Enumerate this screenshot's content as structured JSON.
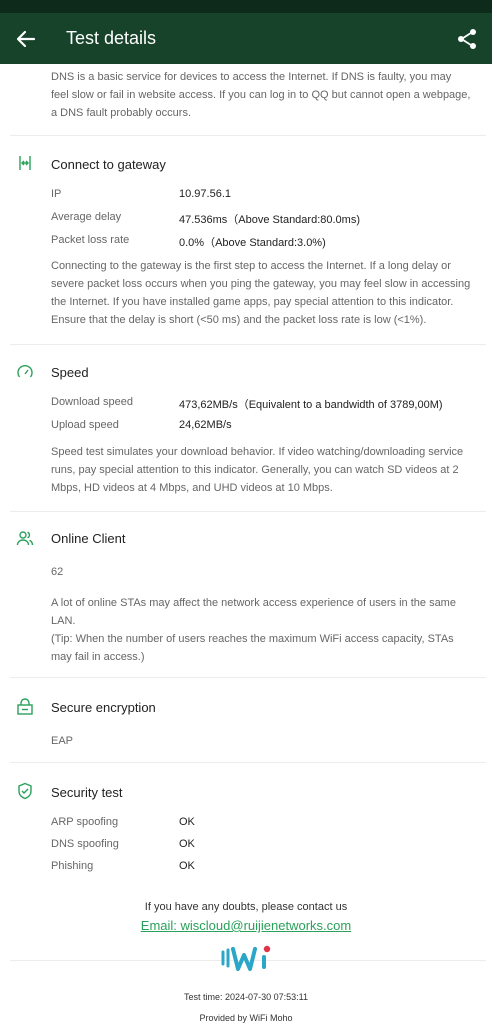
{
  "header": {
    "title": "Test details"
  },
  "dns": {
    "description": "DNS is a basic service for devices to access the Internet. If DNS is faulty, you may feel slow or fail in website access. If you can log in to QQ but cannot open a webpage, a DNS fault probably occurs."
  },
  "gateway": {
    "title": "Connect to gateway",
    "rows": [
      {
        "label": "IP",
        "value": "10.97.56.1"
      },
      {
        "label": "Average delay",
        "value": "47.536ms（Above Standard:80.0ms)"
      },
      {
        "label": "Packet loss rate",
        "value": "0.0%（Above Standard:3.0%)"
      }
    ],
    "description": "Connecting to the gateway is the first step to access the Internet. If a long delay or severe packet loss occurs when you ping the gateway, you may feel slow in accessing the Internet. If you have installed game apps, pay special attention to this indicator. Ensure that the delay is short (<50 ms) and the packet loss rate is low (<1%)."
  },
  "speed": {
    "title": "Speed",
    "rows": [
      {
        "label": "Download speed",
        "value": "473,62MB/s（Equivalent to a bandwidth of 3789,00M)"
      },
      {
        "label": "Upload speed",
        "value": "24,62MB/s"
      }
    ],
    "description": "Speed test simulates your download behavior. If video watching/downloading service runs, pay special attention to this indicator. Generally, you can watch SD videos at 2 Mbps, HD videos at 4 Mbps, and UHD videos at 10 Mbps."
  },
  "online": {
    "title": "Online Client",
    "count": "62",
    "description1": "A lot of online STAs may affect the network access experience of users in the same LAN.",
    "description2": "(Tip: When the number of users reaches the maximum WiFi access capacity, STAs may fail in access.)"
  },
  "encryption": {
    "title": "Secure encryption",
    "value": "EAP"
  },
  "security": {
    "title": "Security test",
    "rows": [
      {
        "label": "ARP spoofing",
        "value": "OK"
      },
      {
        "label": "DNS spoofing",
        "value": "OK"
      },
      {
        "label": "Phishing",
        "value": "OK"
      }
    ]
  },
  "footer": {
    "contact": "If you have any doubts, please contact us",
    "email": "Email: wiscloud@ruijienetworks.com",
    "test_time": "Test time: 2024-07-30 07:53:11",
    "provided_by": "Provided by WiFi Moho"
  },
  "colors": {
    "appbar": "#16432a",
    "accent": "#2aa15a"
  }
}
